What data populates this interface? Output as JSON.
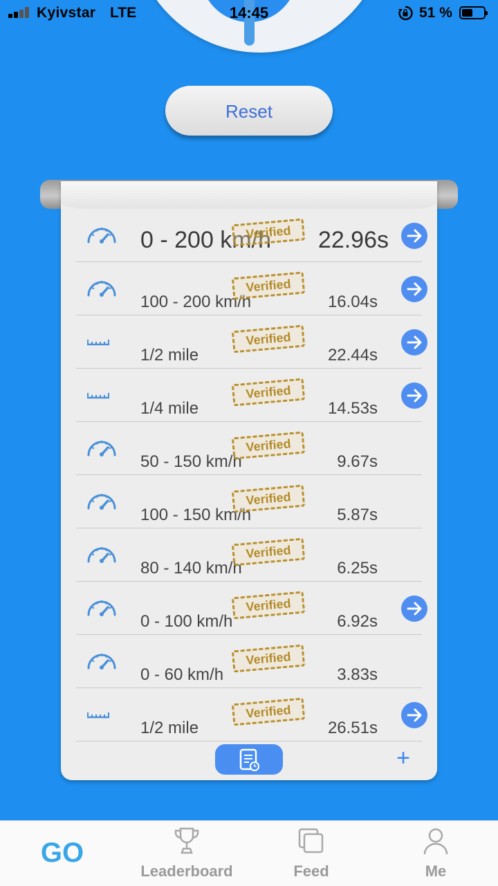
{
  "status_bar": {
    "carrier": "Kyivstar",
    "network": "LTE",
    "time": "14:45",
    "battery_percent": "51 %",
    "battery_level": 0.51
  },
  "reset_label": "Reset",
  "stamp_text": "Verified",
  "records": [
    {
      "label": "0 - 200 km/h",
      "time": "22.96s",
      "icon": "speedometer-icon",
      "has_arrow": true
    },
    {
      "label": "100 - 200 km/h",
      "time": "16.04s",
      "icon": "speedometer-icon",
      "has_arrow": true
    },
    {
      "label": "1/2 mile",
      "time": "22.44s",
      "icon": "ruler-icon",
      "has_arrow": true
    },
    {
      "label": "1/4 mile",
      "time": "14.53s",
      "icon": "ruler-icon",
      "has_arrow": true
    },
    {
      "label": "50 - 150 km/h",
      "time": "9.67s",
      "icon": "speedometer-icon",
      "has_arrow": false
    },
    {
      "label": "100 - 150 km/h",
      "time": "5.87s",
      "icon": "speedometer-icon",
      "has_arrow": false
    },
    {
      "label": "80 - 140 km/h",
      "time": "6.25s",
      "icon": "speedometer-icon",
      "has_arrow": false
    },
    {
      "label": "0 - 100 km/h",
      "time": "6.92s",
      "icon": "speedometer-icon",
      "has_arrow": true
    },
    {
      "label": "0 - 60 km/h",
      "time": "3.83s",
      "icon": "speedometer-icon",
      "has_arrow": false
    },
    {
      "label": "1/2 mile",
      "time": "26.51s",
      "icon": "ruler-icon",
      "has_arrow": true
    }
  ],
  "tabs": [
    {
      "label": "GO",
      "icon": "go-text",
      "active": true
    },
    {
      "label": "Leaderboard",
      "icon": "trophy-icon",
      "active": false
    },
    {
      "label": "Feed",
      "icon": "feed-icon",
      "active": false
    },
    {
      "label": "Me",
      "icon": "person-icon",
      "active": false
    }
  ],
  "colors": {
    "background": "#1e8ff0",
    "accent": "#4f8ef0",
    "stamp": "#b48a28",
    "active_tab": "#3aa6e8"
  }
}
